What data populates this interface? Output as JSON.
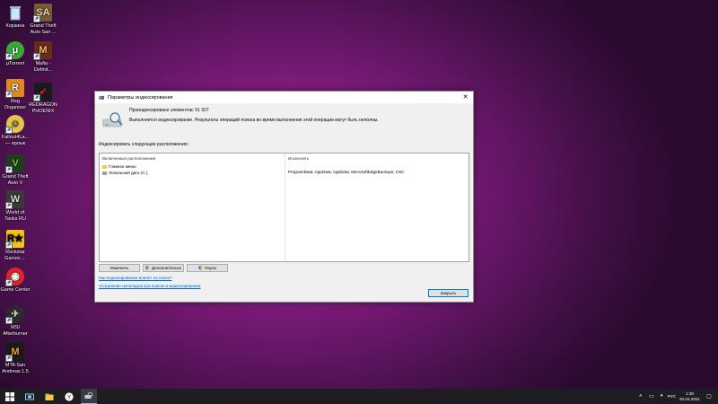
{
  "desktop": {
    "icons": [
      {
        "label": "Корзина",
        "icon": "recycle-bin-icon"
      },
      {
        "label": "μTorrent",
        "icon": "utorrent-icon"
      },
      {
        "label": "Reg Organizer",
        "icon": "reg-organizer-icon"
      },
      {
        "label": "Fallout4La... — ярлык",
        "icon": "fallout-icon"
      },
      {
        "label": "Grand Theft Auto V",
        "icon": "gta5-icon"
      },
      {
        "label": "World of Tanks RU",
        "icon": "wot-icon"
      },
      {
        "label": "Rockstar Games ...",
        "icon": "rockstar-icon"
      },
      {
        "label": "Game Center",
        "icon": "game-center-icon"
      },
      {
        "label": "MSI Afterburner",
        "icon": "msi-afterburner-icon"
      },
      {
        "label": "MTA San Andreas 1.5",
        "icon": "mta-icon"
      },
      {
        "label": "Grand Theft Auto San ...",
        "icon": "gta-sa-icon"
      },
      {
        "label": "Mafia - Definit...",
        "icon": "mafia-icon"
      },
      {
        "label": "REDRAGON PHOENIX",
        "icon": "redragon-icon"
      }
    ]
  },
  "dialog": {
    "title": "Параметры индексирования",
    "count_line": "Проиндексировано элементов: 51 927",
    "status_line": "Выполняется индексирование. Результаты операций поиска во время выполнения этой операции могут быть неполны.",
    "index_label": "Индексировать следующие расположения:",
    "columns": {
      "included": "Включенные расположения",
      "exclude": "Исключить"
    },
    "locations": [
      {
        "name": "Главное меню"
      },
      {
        "name": "Локальный диск (C:)"
      }
    ],
    "exclude_value": "ProgramData; AppData; AppData; MicrosoftEdgeBackups; CSC",
    "buttons": {
      "modify": "Изменить",
      "advanced": "Дополнительно",
      "pause": "Пауза",
      "close": "Закрыть"
    },
    "links": {
      "how_affects": "Как индексирование влияет на поиск?",
      "troubleshoot": "Устранение неполадок при поиске и индексировании"
    }
  },
  "taskbar": {
    "language": "РУС",
    "time": "1:38",
    "date": "20.04.2021"
  },
  "colors": {
    "accent": "#0078d7",
    "link": "#0066cc",
    "desktop_center": "#b0279f"
  }
}
